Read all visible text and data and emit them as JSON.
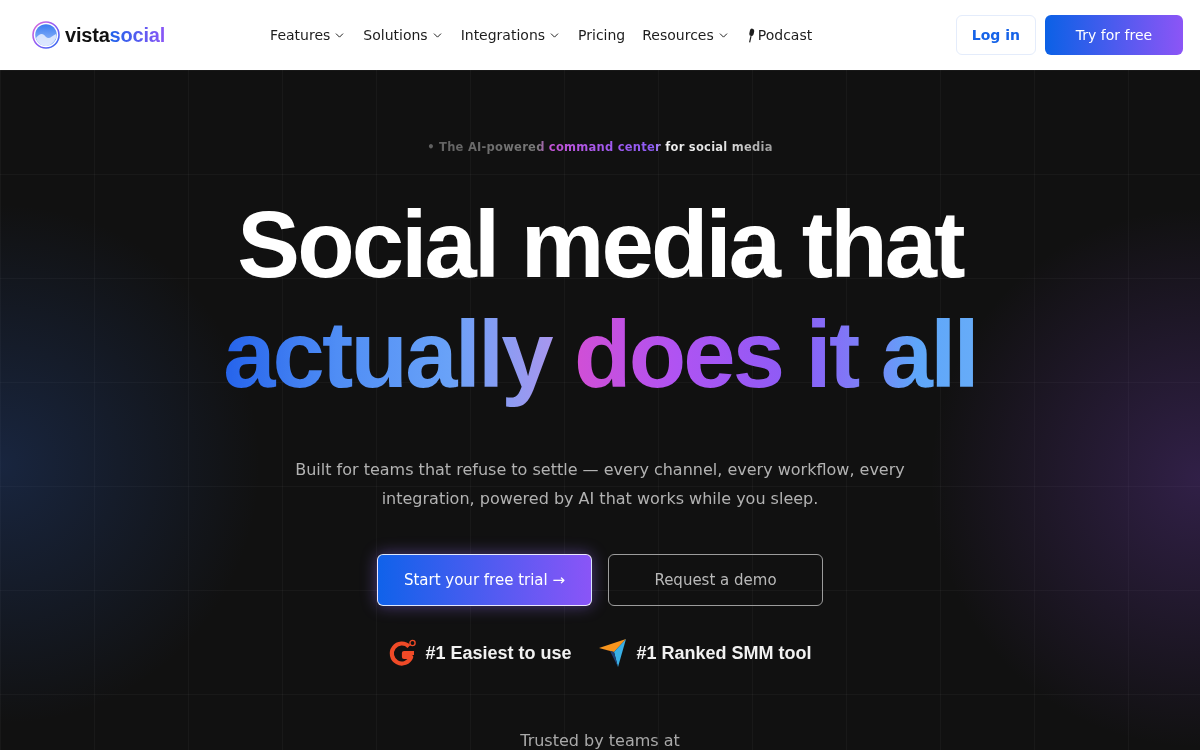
{
  "header": {
    "logo": {
      "words": [
        "vista",
        "social"
      ]
    },
    "nav": [
      {
        "label": "Features",
        "kind": "dropdown"
      },
      {
        "label": "Solutions",
        "kind": "dropdown"
      },
      {
        "label": "Integrations",
        "kind": "dropdown"
      },
      {
        "label": "Pricing",
        "kind": "link"
      },
      {
        "label": "Resources",
        "kind": "dropdown"
      },
      {
        "label": "Podcast",
        "kind": "mic"
      }
    ],
    "actions": [
      {
        "label": "Log in",
        "kind": "outline"
      },
      {
        "label": "Try for free",
        "kind": "gradient"
      }
    ]
  },
  "hero": {
    "tagline": "• The AI-powered command center for social media",
    "headline": [
      {
        "text": "Social media that",
        "kind": "plain"
      },
      {
        "text": "actually does it all",
        "kind": "gradient"
      }
    ],
    "subtitle": "Built for teams that refuse to settle — every channel, every workflow, every integration, powered by AI that works while you sleep.",
    "buttons": [
      {
        "label": "Start your free trial →",
        "kind": "primary"
      },
      {
        "label": "Request a demo",
        "kind": "outline"
      }
    ],
    "badges": [
      {
        "label": "#1 Easiest to use",
        "kind": "arc"
      },
      {
        "label": "#1 Ranked SMM tool",
        "kind": "plane"
      }
    ],
    "trusted_by": "Trusted by teams at"
  }
}
